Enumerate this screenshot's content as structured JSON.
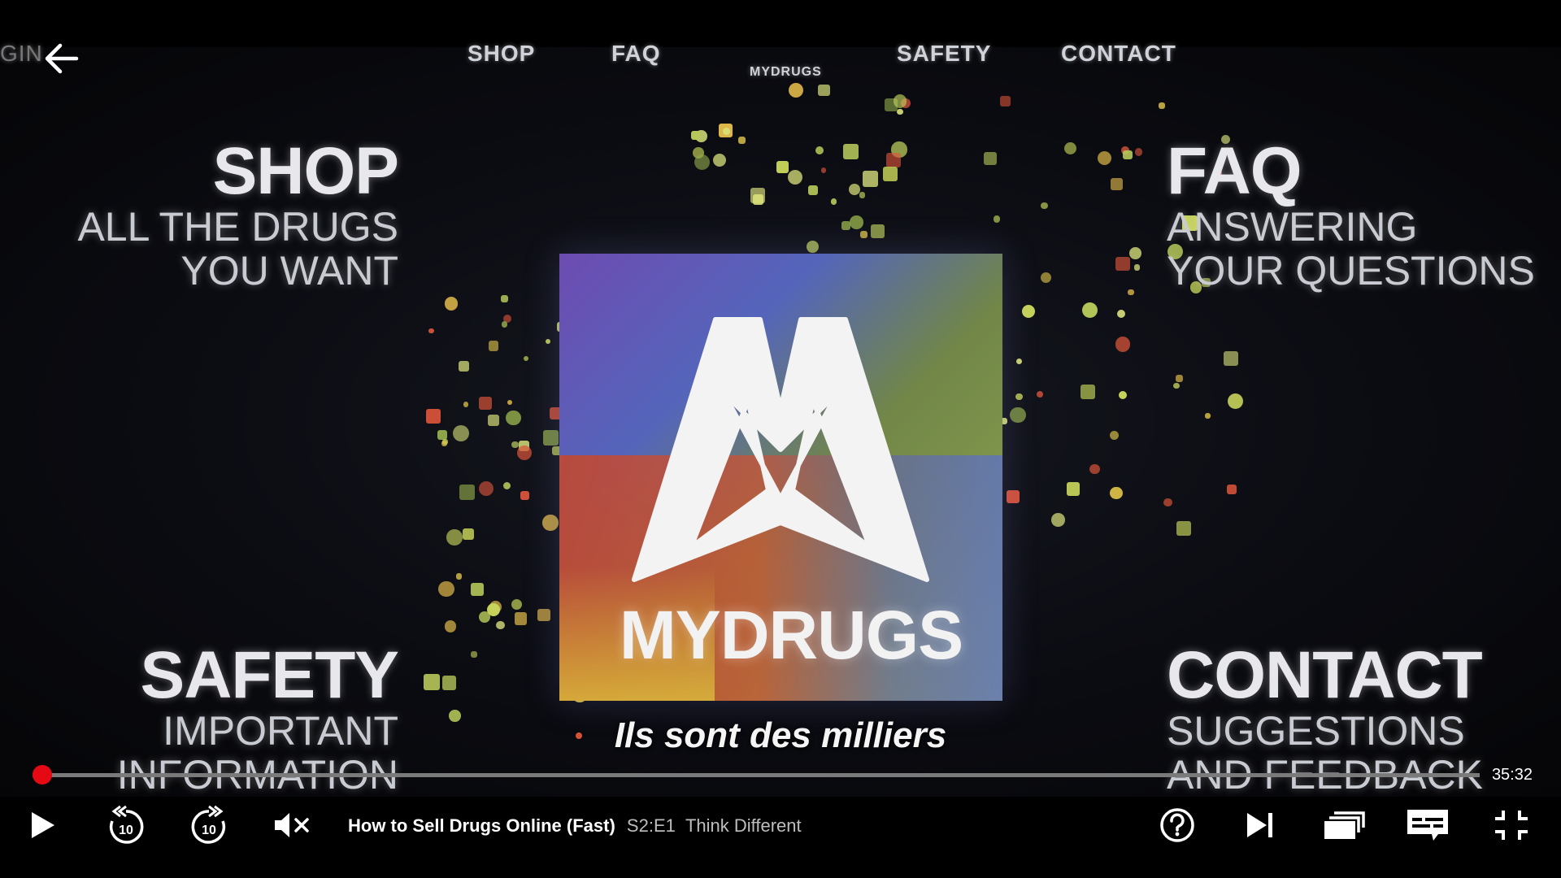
{
  "site_nav": {
    "login_fragment": "GIN",
    "items": [
      "SHOP",
      "FAQ",
      "SAFETY",
      "CONTACT"
    ],
    "logo_small_text": "MYDRUGS"
  },
  "blocks": {
    "shop": {
      "title": "SHOP",
      "line1": "ALL THE DRUGS",
      "line2": "YOU WANT"
    },
    "faq": {
      "title": "FAQ",
      "line1": "ANSWERING",
      "line2": "YOUR QUESTIONS"
    },
    "safety": {
      "title": "SAFETY",
      "line1": "IMPORTANT",
      "line2": "INFORMATION"
    },
    "contact": {
      "title": "CONTACT",
      "line1": "SUGGESTIONS",
      "line2": "AND FEEDBACK"
    }
  },
  "logo": {
    "text": "MYDRUGS"
  },
  "subtitle": "Ils sont des milliers",
  "player": {
    "time_remaining": "35:32",
    "progress_fraction": 0.007,
    "show_title": "How to Sell Drugs Online (Fast)",
    "episode_label": "S2:E1",
    "episode_title": "Think Different",
    "skip_back_seconds": "10",
    "skip_forward_seconds": "10",
    "accent_color": "#e50914"
  },
  "icons": {
    "back": "arrow-left-icon",
    "play": "play-icon",
    "rewind": "rewind-10-icon",
    "forward": "forward-10-icon",
    "volume": "volume-muted-icon",
    "help": "help-icon",
    "next": "next-episode-icon",
    "episodes": "episodes-icon",
    "subtitles": "subtitles-icon",
    "fullscreen_exit": "exit-fullscreen-icon"
  }
}
